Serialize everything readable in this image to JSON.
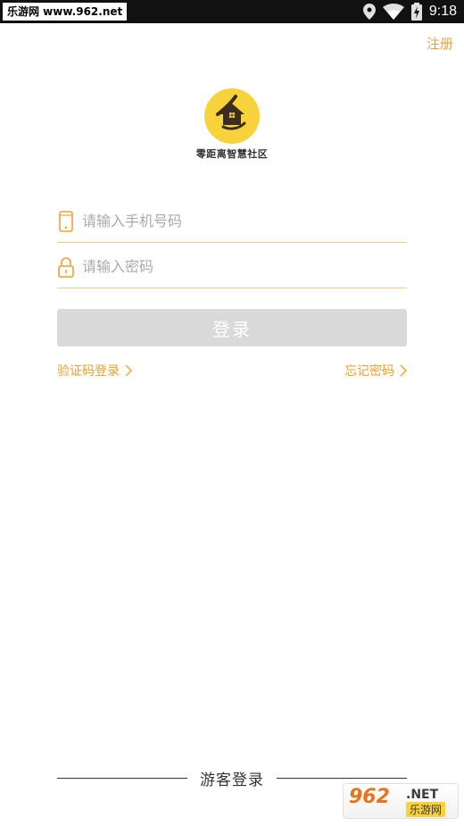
{
  "status_bar": {
    "watermark": "乐游网 www.962.net",
    "time": "9:18",
    "icons": [
      "location-icon",
      "wifi-icon",
      "battery-charging-icon"
    ]
  },
  "header": {
    "register_label": "注册"
  },
  "brand": {
    "app_name": "零距离智慧社区",
    "logo_icon": "house-logo-icon",
    "accent_color": "#f0a02e",
    "logo_color": "#f7d23a"
  },
  "form": {
    "phone_placeholder": "请输入手机号码",
    "phone_value": "",
    "password_placeholder": "请输入密码",
    "password_value": "",
    "login_label": "登录"
  },
  "links": {
    "sms_login": "验证码登录",
    "forgot_password": "忘记密码"
  },
  "footer": {
    "guest_login": "游客登录",
    "watermark_num": "962",
    "watermark_net": ".NET",
    "watermark_cn": "乐游网"
  }
}
